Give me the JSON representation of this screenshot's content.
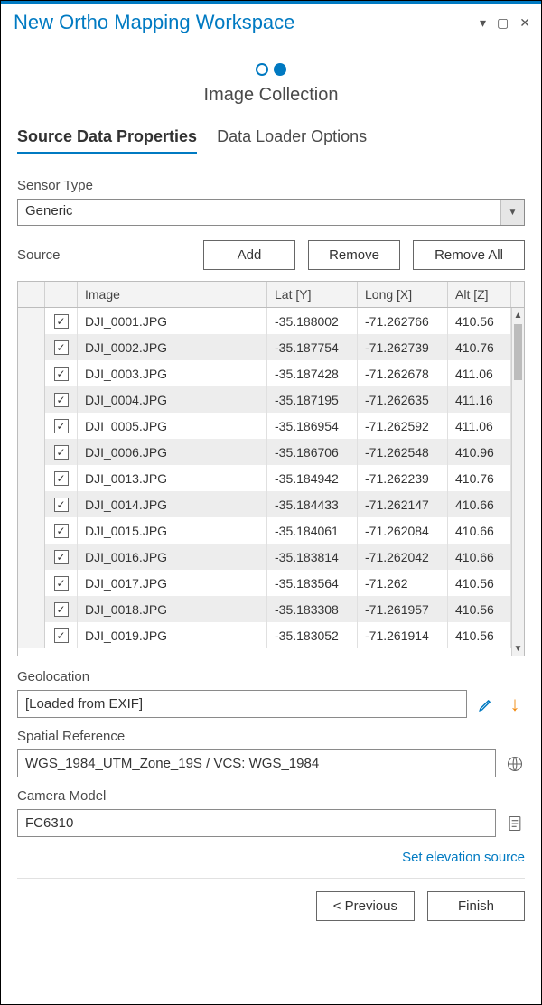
{
  "window": {
    "title": "New Ortho Mapping Workspace"
  },
  "stepper": {
    "title": "Image Collection"
  },
  "tabs": {
    "a": "Source Data Properties",
    "b": "Data Loader Options"
  },
  "sensor": {
    "label": "Sensor Type",
    "value": "Generic"
  },
  "source": {
    "label": "Source",
    "add": "Add",
    "remove": "Remove",
    "remove_all": "Remove All"
  },
  "table": {
    "headers": {
      "image": "Image",
      "lat": "Lat [Y]",
      "lon": "Long [X]",
      "alt": "Alt [Z]"
    },
    "rows": [
      {
        "image": "DJI_0001.JPG",
        "lat": "-35.188002",
        "lon": "-71.262766",
        "alt": "410.56"
      },
      {
        "image": "DJI_0002.JPG",
        "lat": "-35.187754",
        "lon": "-71.262739",
        "alt": "410.76"
      },
      {
        "image": "DJI_0003.JPG",
        "lat": "-35.187428",
        "lon": "-71.262678",
        "alt": "411.06"
      },
      {
        "image": "DJI_0004.JPG",
        "lat": "-35.187195",
        "lon": "-71.262635",
        "alt": "411.16"
      },
      {
        "image": "DJI_0005.JPG",
        "lat": "-35.186954",
        "lon": "-71.262592",
        "alt": "411.06"
      },
      {
        "image": "DJI_0006.JPG",
        "lat": "-35.186706",
        "lon": "-71.262548",
        "alt": "410.96"
      },
      {
        "image": "DJI_0013.JPG",
        "lat": "-35.184942",
        "lon": "-71.262239",
        "alt": "410.76"
      },
      {
        "image": "DJI_0014.JPG",
        "lat": "-35.184433",
        "lon": "-71.262147",
        "alt": "410.66"
      },
      {
        "image": "DJI_0015.JPG",
        "lat": "-35.184061",
        "lon": "-71.262084",
        "alt": "410.66"
      },
      {
        "image": "DJI_0016.JPG",
        "lat": "-35.183814",
        "lon": "-71.262042",
        "alt": "410.66"
      },
      {
        "image": "DJI_0017.JPG",
        "lat": "-35.183564",
        "lon": "-71.262",
        "alt": "410.56"
      },
      {
        "image": "DJI_0018.JPG",
        "lat": "-35.183308",
        "lon": "-71.261957",
        "alt": "410.56"
      },
      {
        "image": "DJI_0019.JPG",
        "lat": "-35.183052",
        "lon": "-71.261914",
        "alt": "410.56"
      }
    ]
  },
  "geolocation": {
    "label": "Geolocation",
    "value": "[Loaded from EXIF]"
  },
  "spatial_ref": {
    "label": "Spatial Reference",
    "value": "WGS_1984_UTM_Zone_19S / VCS: WGS_1984"
  },
  "camera": {
    "label": "Camera Model",
    "value": "FC6310"
  },
  "link": {
    "elevation": "Set elevation source"
  },
  "footer": {
    "prev": "< Previous",
    "finish": "Finish"
  }
}
